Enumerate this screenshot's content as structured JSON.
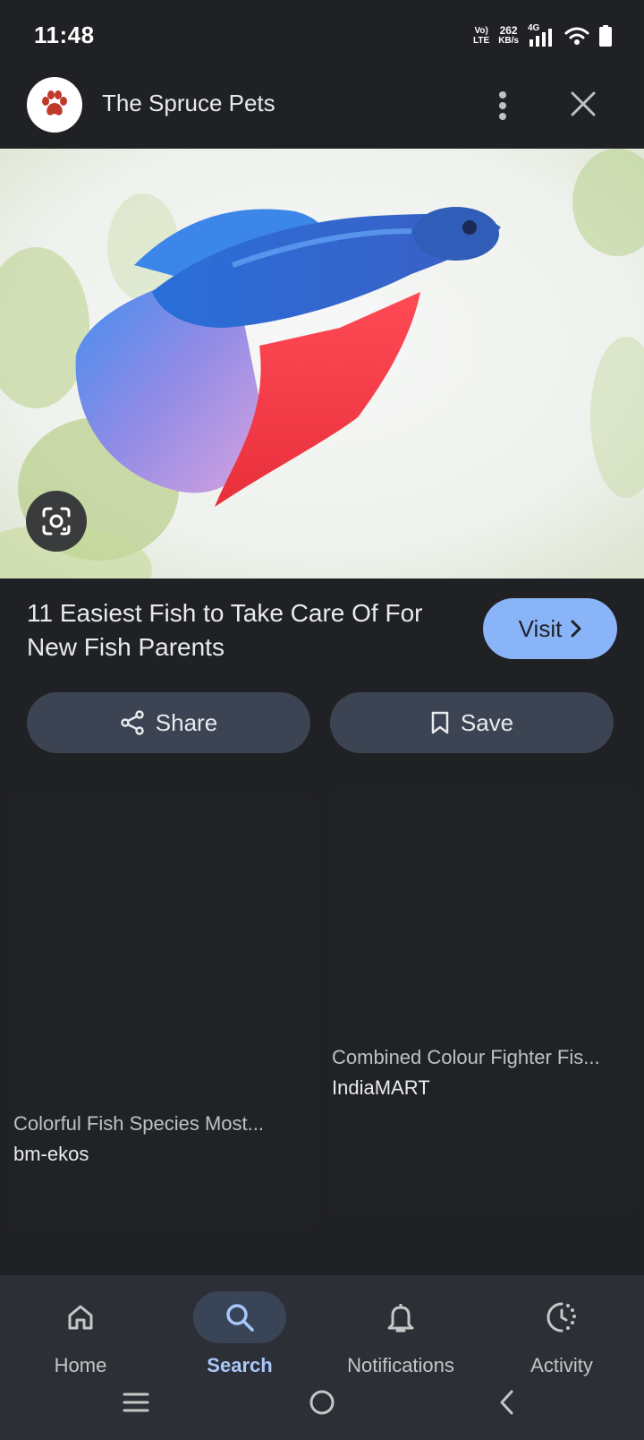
{
  "status_bar": {
    "time": "11:48",
    "volte_top": "Vo)",
    "volte_bottom": "LTE",
    "speed_value": "262",
    "speed_unit": "KB/s",
    "network": "4G"
  },
  "header": {
    "site_name": "The Spruce Pets",
    "logo_icon": "paw-icon"
  },
  "hero": {
    "image_alt": "blue and red betta fish",
    "lens_icon": "google-lens-icon"
  },
  "article": {
    "title": "11 Easiest Fish to Take Care Of For New Fish Parents",
    "visit_label": "Visit"
  },
  "actions": {
    "share_label": "Share",
    "save_label": "Save"
  },
  "results": [
    {
      "title": "Colorful Fish Species Most...",
      "source": "bm-ekos"
    },
    {
      "title": "Combined Colour Fighter Fis...",
      "source": "IndiaMART"
    }
  ],
  "bottom_nav": {
    "items": [
      {
        "label": "Home",
        "icon": "home-icon"
      },
      {
        "label": "Search",
        "icon": "search-icon",
        "active": true
      },
      {
        "label": "Notifications",
        "icon": "bell-icon"
      },
      {
        "label": "Activity",
        "icon": "activity-icon"
      }
    ]
  },
  "colors": {
    "background": "#202124",
    "accent": "#8ab4f8",
    "button": "#3c4454",
    "nav_bar": "#2c2f36"
  }
}
